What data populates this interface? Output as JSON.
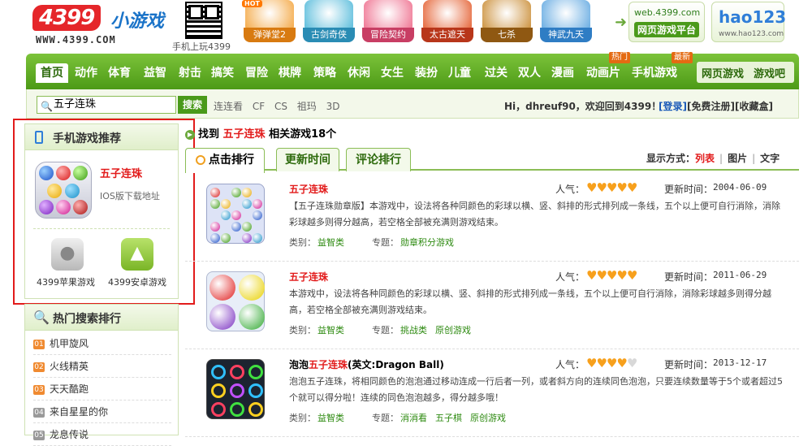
{
  "header": {
    "logo_main": "4399",
    "logo_sub": "小游戏",
    "logo_url": "WWW.4399.COM",
    "qr_label": "手机上玩4399",
    "games": [
      {
        "name": "弹弹堂2",
        "color": "#f3a33a",
        "cap": "#d87a10"
      },
      {
        "name": "古剑奇侠",
        "color": "#4fb8d9",
        "cap": "#2a8cb4"
      },
      {
        "name": "冒险契约",
        "color": "#ee6a8a",
        "cap": "#c83e64"
      },
      {
        "name": "太古遮天",
        "color": "#e35a2a",
        "cap": "#b8361a"
      },
      {
        "name": "七杀",
        "color": "#c8892f",
        "cap": "#8f5812"
      },
      {
        "name": "神武九天",
        "color": "#5da6e0",
        "cap": "#2f7dc4"
      }
    ],
    "hot_badge": "HOT",
    "web_link_url": "web.4399.com",
    "web_link_label": "网页游戏平台",
    "hao_label": "hao123",
    "hao_url": "www.hao123.com"
  },
  "nav": {
    "items": [
      "首页",
      "动作",
      "体育",
      "益智",
      "射击",
      "搞笑",
      "冒险",
      "棋牌",
      "策略",
      "休闲",
      "女生",
      "装扮",
      "儿童",
      "过关",
      "双人",
      "漫画",
      "动画片",
      "手机游戏"
    ],
    "badge_hot": "热门",
    "badge_new": "最新",
    "right_1": "网页游戏",
    "right_2": "游戏吧"
  },
  "search": {
    "value": "五子连珠",
    "button": "搜索",
    "hot_words": [
      "连连看",
      "CF",
      "CS",
      "祖玛",
      "3D"
    ],
    "user_greeting": "Hi，dhreuf90，欢迎回到4399！",
    "login": "[登录]",
    "register": "[免费注册]",
    "favorite": "[收藏盒]"
  },
  "sidebar": {
    "mobile_title": "手机游戏推荐",
    "mobile_game_name": "五子连珠",
    "mobile_game_download": "IOS版下载地址",
    "apple_label": "4399苹果游戏",
    "android_label": "4399安卓游戏",
    "hot_title": "热门搜索排行",
    "hot_items": [
      {
        "num": "01",
        "name": "机甲旋风"
      },
      {
        "num": "02",
        "name": "火线精英"
      },
      {
        "num": "03",
        "name": "天天酷跑"
      },
      {
        "num": "04",
        "name": "来自星星的你"
      },
      {
        "num": "05",
        "name": "龙息传说"
      }
    ]
  },
  "main": {
    "found_prefix": "找到",
    "found_keyword": "五子连珠",
    "found_suffix": "相关游戏18个",
    "tabs": [
      "点击排行",
      "更新时间",
      "评论排行"
    ],
    "display_label": "显示方式：",
    "display_list": "列表",
    "display_image": "图片",
    "display_text": "文字",
    "popularity_label": "人气：",
    "update_label": "更新时间：",
    "category_label": "类别：",
    "topic_label": "专题：",
    "games": [
      {
        "title_red": "五子连珠",
        "title_black": "",
        "hearts": 5,
        "date": "2004-06-09",
        "desc": "【五子连珠勋章版】本游戏中，设法将各种同颜色的彩球以横、竖、斜排的形式排列成一条线，五个以上便可自行消除，消除彩球越多则得分越高，若空格全部被充满则游戏结束。",
        "category": "益智类",
        "topics": [
          "勋章积分游戏"
        ]
      },
      {
        "title_red": "五子连珠",
        "title_black": "",
        "hearts": 5,
        "date": "2011-06-29",
        "desc": "本游戏中，设法将各种同颜色的彩球以横、竖、斜排的形式排列成一条线，五个以上便可自行消除，消除彩球越多则得分越高，若空格全部被充满则游戏结束。",
        "category": "益智类",
        "topics": [
          "挑战类",
          "原创游戏"
        ]
      },
      {
        "title_pre": "泡泡",
        "title_red": "五子连珠",
        "title_black": "(英文:Dragon Ball)",
        "hearts": 4,
        "date": "2013-12-17",
        "desc": "泡泡五子连珠，将相同颜色的泡泡通过移动连成一行后者一列，或者斜方向的连续同色泡泡，只要连续数量等于5个或者超过5个就可以得分啦！连续的同色泡泡越多，得分越多哦！",
        "category": "益智类",
        "topics": [
          "消消看",
          "五子棋",
          "原创游戏"
        ]
      }
    ]
  },
  "colors": {
    "nav_green": "#5aa820",
    "highlight_red": "#e21b1b",
    "heart_orange": "#f7a01c"
  }
}
